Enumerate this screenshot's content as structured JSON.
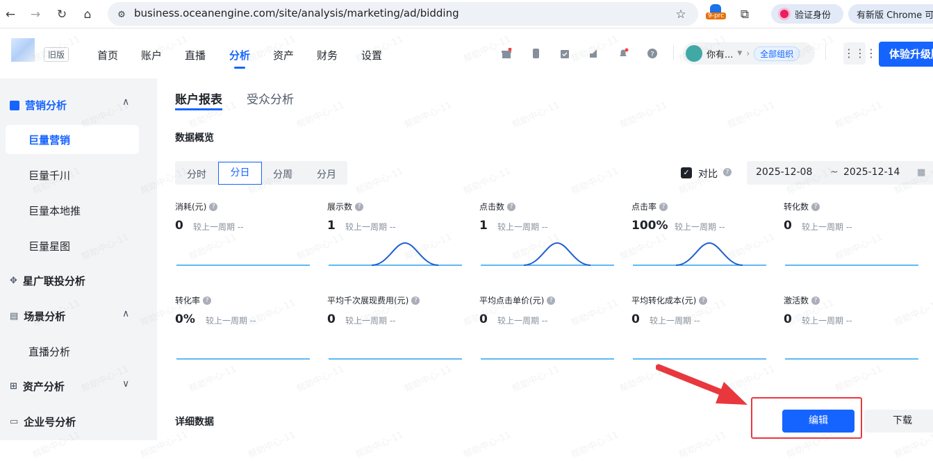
{
  "browser": {
    "url": "business.oceanengine.com/site/analysis/marketing/ad/bidding",
    "ext_badge": "9-prc",
    "verify_label": "验证身份",
    "update_label": "有新版 Chrome 可"
  },
  "header": {
    "old_version": "旧版",
    "menu": [
      "首页",
      "账户",
      "直播",
      "分析",
      "资产",
      "财务",
      "设置"
    ],
    "active": "分析",
    "user": "你有...",
    "org": "全部组织",
    "upgrade": "体验升级版"
  },
  "sidebar": {
    "marketing": "营销分析",
    "items": [
      "巨量营销",
      "巨量千川",
      "巨量本地推",
      "巨量星图"
    ],
    "star": "星广联投分析",
    "scene": "场景分析",
    "scene_items": [
      "直播分析"
    ],
    "assets": "资产分析",
    "enterprise": "企业号分析"
  },
  "main": {
    "tabs": [
      "账户报表",
      "受众分析"
    ],
    "overview": "数据概览",
    "granularity": [
      "分时",
      "分日",
      "分周",
      "分月"
    ],
    "compare": "对比",
    "date_start": "2025-12-08",
    "date_sep": "~",
    "date_end": "2025-12-14",
    "detail": "详细数据",
    "edit": "编辑",
    "download": "下载",
    "compare_text": "较上一周期 --",
    "metrics": [
      {
        "label": "消耗(元)",
        "value": "0"
      },
      {
        "label": "展示数",
        "value": "1"
      },
      {
        "label": "点击数",
        "value": "1"
      },
      {
        "label": "点击率",
        "value": "100%"
      },
      {
        "label": "转化数",
        "value": "0"
      },
      {
        "label": "转化率",
        "value": "0%"
      },
      {
        "label": "平均千次展现费用(元)",
        "value": "0"
      },
      {
        "label": "平均点击单价(元)",
        "value": "0"
      },
      {
        "label": "平均转化成本(元)",
        "value": "0"
      },
      {
        "label": "激活数",
        "value": "0"
      }
    ]
  },
  "colors": {
    "primary": "#1664ff",
    "sidebar_bg": "#f3f4f6",
    "spark": "#2aa1f0",
    "highlight": "#e8383d"
  },
  "icons": [
    "back-icon",
    "forward-icon",
    "reload-icon",
    "home-icon",
    "site-info-icon",
    "star-icon",
    "extensions-icon",
    "gift-icon",
    "phone-icon",
    "clipboard-icon",
    "share-icon",
    "bell-icon",
    "help-icon",
    "apps-grid-icon",
    "calendar-icon",
    "chevron-up-icon",
    "chevron-down-icon"
  ]
}
